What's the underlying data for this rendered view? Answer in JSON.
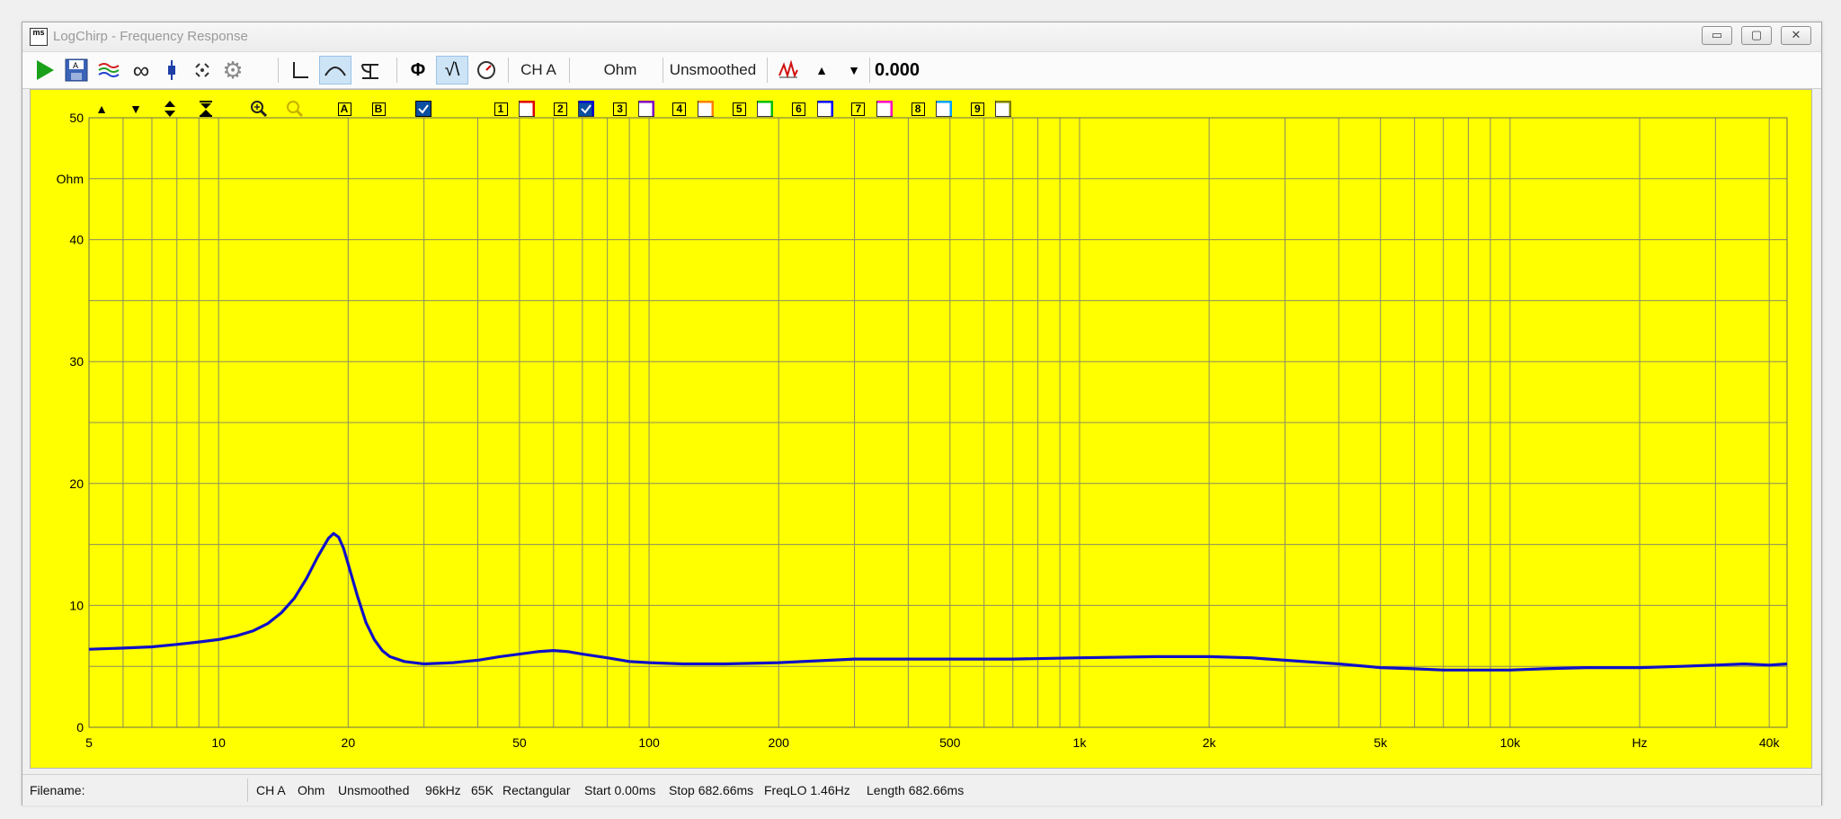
{
  "window": {
    "title": "LogChirp - Frequency Response",
    "app_icon_text": "ms"
  },
  "window_controls": [
    "minimize",
    "maximize",
    "close"
  ],
  "toolbar": {
    "items": [
      {
        "name": "run-button",
        "icon": "play-icon"
      },
      {
        "name": "save-button",
        "icon": "save-icon"
      },
      {
        "name": "overlay-button",
        "icon": "waves-icon"
      },
      {
        "name": "loop-button",
        "icon": "infinity-icon"
      },
      {
        "name": "marker-button",
        "icon": "marker-icon"
      },
      {
        "name": "fit-button",
        "icon": "fit-icon"
      },
      {
        "name": "settings-button",
        "icon": "gear-icon"
      }
    ],
    "channel_label": "CH A",
    "unit_label": "Ohm",
    "smoothing_label": "Unsmoothed",
    "readout_value": "0.000"
  },
  "chart_toolbar": {
    "label_a": "A",
    "label_b": "B",
    "trace_numbers": [
      "1",
      "2",
      "3",
      "4",
      "5",
      "6",
      "7",
      "8",
      "9"
    ],
    "trace_colors": [
      "#e00000",
      "#0000cc",
      "#8000c0",
      "#ff8000",
      "#00c000",
      "#0000ff",
      "#ff00c0",
      "#00a0ff",
      "#808000"
    ],
    "trace_checked": [
      false,
      true,
      false,
      false,
      false,
      false,
      false,
      false,
      false
    ]
  },
  "chart_data": {
    "type": "line",
    "title": "",
    "xlabel": "",
    "ylabel": "",
    "x_scale": "log",
    "xlim": [
      5,
      44000
    ],
    "ylim": [
      0,
      50
    ],
    "y_unit_label": "Ohm",
    "x_unit_label": "Hz",
    "x_tick_labels": [
      {
        "value": 5,
        "label": "5"
      },
      {
        "value": 10,
        "label": "10"
      },
      {
        "value": 20,
        "label": "20"
      },
      {
        "value": 50,
        "label": "50"
      },
      {
        "value": 100,
        "label": "100"
      },
      {
        "value": 200,
        "label": "200"
      },
      {
        "value": 500,
        "label": "500"
      },
      {
        "value": 1000,
        "label": "1k"
      },
      {
        "value": 2000,
        "label": "2k"
      },
      {
        "value": 5000,
        "label": "5k"
      },
      {
        "value": 10000,
        "label": "10k"
      },
      {
        "value": 20000,
        "label": "Hz"
      },
      {
        "value": 40000,
        "label": "40k"
      }
    ],
    "y_tick_labels": [
      {
        "value": 0,
        "label": "0"
      },
      {
        "value": 10,
        "label": "10"
      },
      {
        "value": 20,
        "label": "20"
      },
      {
        "value": 30,
        "label": "30"
      },
      {
        "value": 40,
        "label": "40"
      },
      {
        "value": 45,
        "label": "Ohm"
      },
      {
        "value": 50,
        "label": "50"
      }
    ],
    "grid": true,
    "background": "#ffff00",
    "series": [
      {
        "color": "#1010c8",
        "x": [
          5,
          6,
          7,
          8,
          9,
          10,
          11,
          12,
          13,
          14,
          15,
          16,
          17,
          18,
          18.5,
          19,
          19.5,
          20,
          21,
          22,
          23,
          24,
          25,
          27,
          30,
          35,
          40,
          45,
          50,
          55,
          60,
          65,
          70,
          80,
          90,
          100,
          120,
          150,
          200,
          300,
          500,
          700,
          1000,
          1500,
          2000,
          2500,
          3000,
          4000,
          5000,
          6000,
          7000,
          8000,
          10000,
          12000,
          15000,
          20000,
          25000,
          30000,
          35000,
          40000,
          44000
        ],
        "y": [
          6.4,
          6.5,
          6.6,
          6.8,
          7.0,
          7.2,
          7.5,
          7.9,
          8.5,
          9.4,
          10.6,
          12.2,
          14.0,
          15.5,
          15.9,
          15.6,
          14.7,
          13.4,
          10.8,
          8.6,
          7.2,
          6.3,
          5.8,
          5.4,
          5.2,
          5.3,
          5.5,
          5.8,
          6.0,
          6.2,
          6.3,
          6.2,
          6.0,
          5.7,
          5.4,
          5.3,
          5.2,
          5.2,
          5.3,
          5.6,
          5.6,
          5.6,
          5.7,
          5.8,
          5.8,
          5.7,
          5.5,
          5.2,
          4.9,
          4.8,
          4.7,
          4.7,
          4.7,
          4.8,
          4.9,
          4.9,
          5.0,
          5.1,
          5.2,
          5.1,
          5.2
        ]
      }
    ]
  },
  "statusbar": {
    "filename_label": "Filename:",
    "channel": "CH A",
    "unit": "Ohm",
    "smoothing": "Unsmoothed",
    "sample_rate": "96kHz",
    "length_points": "65K",
    "window": "Rectangular",
    "start": "Start 0.00ms",
    "stop": "Stop 682.66ms",
    "freq_lo": "FreqLO 1.46Hz",
    "length": "Length 682.66ms"
  }
}
